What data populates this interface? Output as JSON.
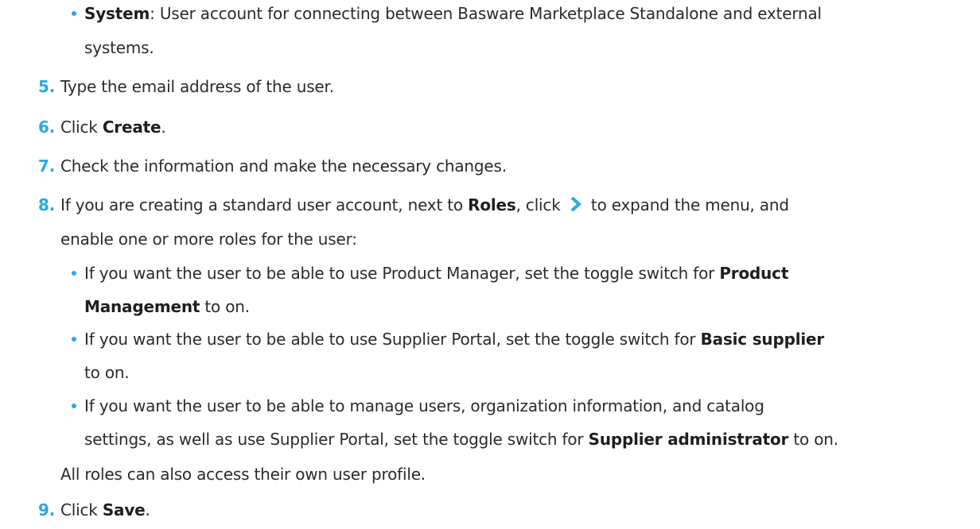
{
  "system_item": {
    "term": "System",
    "text_a": ": User account for connecting between Basware Marketplace Standalone and external",
    "text_b": "systems."
  },
  "steps": [
    {
      "num": "5.",
      "text": "Type the email address of the user."
    },
    {
      "num": "6.",
      "pre": "Click ",
      "bold": "Create",
      "post": "."
    },
    {
      "num": "7.",
      "text": "Check the information and make the necessary changes."
    },
    {
      "num": "8.",
      "pre": "If you are creating a standard user account, next to ",
      "bold": "Roles",
      "mid": ", click ",
      "post": " to expand the menu, and",
      "line2": "enable one or more roles for the user:"
    },
    {
      "num": "9.",
      "pre": "Click ",
      "bold": "Save",
      "post": "."
    }
  ],
  "sub_bullets": [
    {
      "l1_pre": "If you want the user to be able to use Product Manager, set the toggle switch for ",
      "l1_bold": "Product",
      "l2_bold": "Management",
      "l2_post": " to on."
    },
    {
      "l1_pre": "If you want the user to be able to use Supplier Portal, set the toggle switch for ",
      "l1_bold": "Basic supplier",
      "l2_post": "to on."
    },
    {
      "l1_pre": "If you want the user to be able to manage users, organization information, and catalog",
      "l2_pre": "settings, as well as use Supplier Portal, set the toggle switch for ",
      "l2_bold": "Supplier administrator",
      "l2_post": " to on."
    }
  ],
  "note": "All roles can also access their own user profile.",
  "icons": {
    "expand": "chevron-right-icon"
  },
  "colors": {
    "accent": "#2aa8e0",
    "text": "#2b2b2b"
  }
}
